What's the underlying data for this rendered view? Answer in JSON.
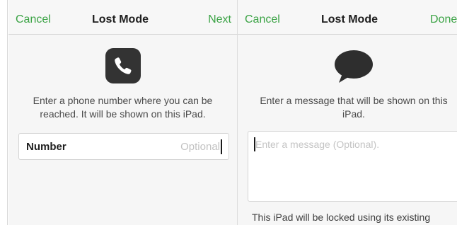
{
  "left_panel": {
    "nav": {
      "cancel_label": "Cancel",
      "title": "Lost Mode",
      "next_label": "Next"
    },
    "icon": "phone-icon",
    "description": "Enter a phone number where you can be reached. It will be shown on this iPad.",
    "number_field": {
      "label": "Number",
      "value": "",
      "placeholder": "Optional"
    }
  },
  "right_panel": {
    "nav": {
      "cancel_label": "Cancel",
      "title": "Lost Mode",
      "done_label": "Done"
    },
    "icon": "speech-bubble-icon",
    "description": "Enter a message that will be shown on this iPad.",
    "message_field": {
      "value": "",
      "placeholder": "Enter a message (Optional)."
    },
    "footer": "This iPad will be locked using its existing"
  },
  "colors": {
    "accent": "#3ba345",
    "icon_fill": "#333333",
    "panel_bg": "#f6f6f6"
  }
}
